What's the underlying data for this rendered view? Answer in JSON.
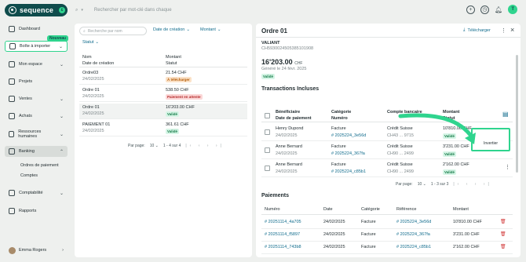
{
  "app": {
    "name": "sequence",
    "logo_badge": "ε"
  },
  "topbar": {
    "search_placeholder": "Rechercher par mot-clé dans chaque",
    "avatar_initials": "T",
    "icons": [
      "plus-icon",
      "clock-icon",
      "bell-icon"
    ]
  },
  "sidebar": {
    "items": [
      {
        "label": "Dashboard",
        "icon": "home-icon"
      },
      {
        "label": "Boîte à importer",
        "icon": "inbox-icon",
        "badge": "Nouveau"
      },
      {
        "label": "Mon espace",
        "icon": "user-icon"
      },
      {
        "label": "Projets",
        "icon": "check-icon"
      },
      {
        "label": "Ventes",
        "icon": "cart-icon"
      },
      {
        "label": "Achats",
        "icon": "bag-icon"
      },
      {
        "label": "Ressources humaines",
        "icon": "people-icon"
      },
      {
        "label": "Banking",
        "icon": "bank-icon"
      },
      {
        "label": "Comptabilité",
        "icon": "calculator-icon"
      },
      {
        "label": "Rapports",
        "icon": "chart-icon"
      }
    ],
    "sub_items": [
      "Ordres de paiement",
      "Comptes"
    ],
    "user": "Emma Rogers"
  },
  "list": {
    "search_placeholder": "Recherche par nom",
    "filters": [
      "Date de création",
      "Montant",
      "Statut"
    ],
    "headers": {
      "c1": "Nom",
      "c1b": "Date de création",
      "c2": "Montant",
      "c2b": "Statut"
    },
    "rows": [
      {
        "name": "Ordre03",
        "date": "24/02/2025",
        "amount": "21.54 CHF",
        "status": "À télécharger",
        "status_class": "b-orange"
      },
      {
        "name": "Ordre 01",
        "date": "24/02/2025",
        "amount": "538.50 CHF",
        "status": "Paiement en attente",
        "status_class": "b-red"
      },
      {
        "name": "Ordre 01",
        "date": "24/02/2025",
        "amount": "16'203.00 CHF",
        "status": "Validé",
        "status_class": "b-green"
      },
      {
        "name": "PAIEMENT 01",
        "date": "24/02/2025",
        "amount": "361.61 CHF",
        "status": "Validé",
        "status_class": "b-green"
      }
    ],
    "pager": {
      "label": "Par page:",
      "per_page": "10",
      "range": "1 - 4 sur 4"
    }
  },
  "detail": {
    "title": "Ordre 01",
    "download_label": "Télécharger",
    "vendor": "VALIANT",
    "reference": "CH5930024505385101908",
    "amount": "16'203.00",
    "currency": "CHF",
    "generated": "Généré le 24 févr. 2025",
    "status": "Validé",
    "transactions_title": "Transactions Incluses",
    "tx_headers": {
      "c1": "Bénéficiaire",
      "c1b": "Date de paiement",
      "c2": "Catégorie",
      "c2b": "Numéro",
      "c3": "Compte bancaire",
      "c4": "Montant",
      "c4b": "Statut"
    },
    "transactions": [
      {
        "name": "Henry Dupond",
        "date": "24/02/2025",
        "category": "Facture",
        "number": "# 2025224_3e56d",
        "bank": "Crédit Suisse",
        "account": "CH43 ... 9715",
        "amount": "10'810.00 CHF",
        "status": "Validé"
      },
      {
        "name": "Anne Bernard",
        "date": "24/02/2025",
        "category": "Facture",
        "number": "# 2025224_367fa",
        "bank": "Crédit Suisse",
        "account": "CH90 ... 2499",
        "amount": "3'231.00 CHF",
        "status": "Validé"
      },
      {
        "name": "Anne Bernard",
        "date": "24/02/2025",
        "category": "Facture",
        "number": "# 2025224_c85b1",
        "bank": "Crédit Suisse",
        "account": "CH90 ... 2499",
        "amount": "2'162.00 CHF",
        "status": "Validé"
      }
    ],
    "popover_item": "Invertier",
    "tx_pager": {
      "label": "Par page:",
      "per_page": "10",
      "range": "1 - 3 sur 3"
    },
    "payments_title": "Paiements",
    "pay_headers": {
      "c1": "Numéro",
      "c2": "Date",
      "c3": "Catégorie",
      "c4": "Référence",
      "c5": "Montant"
    },
    "payments": [
      {
        "number": "# 20251114_4a705",
        "date": "24/02/2025",
        "category": "Facture",
        "reference": "# 2025224_3e56d",
        "amount": "10'810.00 CHF"
      },
      {
        "number": "# 20251114_f5897",
        "date": "24/02/2025",
        "category": "Facture",
        "reference": "# 2025224_367fa",
        "amount": "3'231.00 CHF"
      },
      {
        "number": "# 20251114_743b8",
        "date": "24/02/2025",
        "category": "Facture",
        "reference": "# 2025224_c85b1",
        "amount": "2'162.00 CHF"
      }
    ]
  },
  "colors": {
    "brand": "#0f4c4c",
    "accent": "#2fd48e",
    "link": "#0f6b8c"
  }
}
